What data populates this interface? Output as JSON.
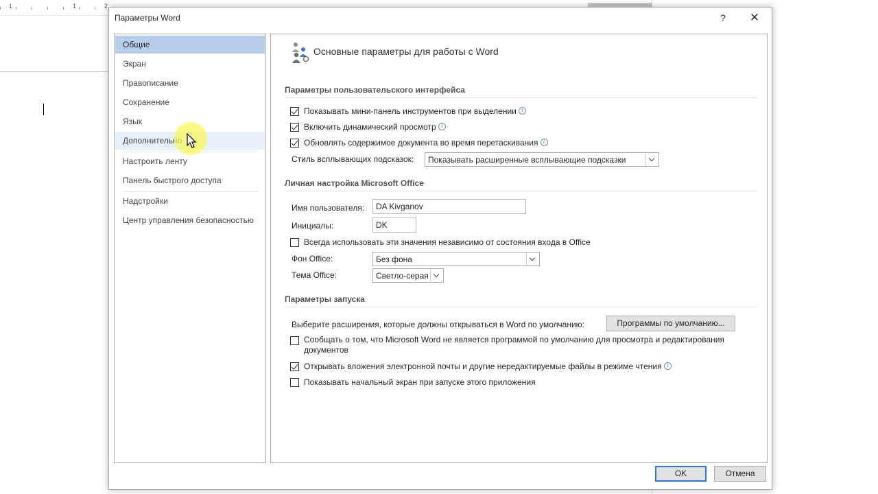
{
  "document": {
    "ruler_numbers": [
      "1",
      "1",
      "2"
    ]
  },
  "dialog": {
    "title": "Параметры Word",
    "help_glyph": "?",
    "close_glyph": "✕"
  },
  "nav": {
    "items": [
      {
        "label": "Общие"
      },
      {
        "label": "Экран"
      },
      {
        "label": "Правописание"
      },
      {
        "label": "Сохранение"
      },
      {
        "label": "Язык"
      },
      {
        "label": "Дополнительно"
      },
      {
        "label": "Настроить ленту"
      },
      {
        "label": "Панель быстрого доступа"
      },
      {
        "label": "Надстройки"
      },
      {
        "label": "Центр управления безопасностью"
      }
    ],
    "selected_index": 0,
    "hover_index": 5
  },
  "content": {
    "header": "Основные параметры для работы с Word",
    "ui_section": {
      "title": "Параметры пользовательского интерфейса",
      "checkboxes": [
        {
          "label": "Показывать мини-панель инструментов при выделении",
          "checked": true,
          "info": true
        },
        {
          "label": "Включить динамический просмотр",
          "checked": true,
          "info": true
        },
        {
          "label": "Обновлять содержимое документа во время перетаскивания",
          "checked": true,
          "info": true
        }
      ],
      "tooltip_style_label": "Стиль всплывающих подсказок:",
      "tooltip_style_value": "Показывать расширенные всплывающие подсказки"
    },
    "personal_section": {
      "title": "Личная настройка Microsoft Office",
      "username_label": "Имя пользователя:",
      "username_value": "DA Kivganov",
      "initials_label": "Инициалы:",
      "initials_value": "DK",
      "always_use_label": "Всегда использовать эти значения независимо от состояния входа в Office",
      "always_use_checked": false,
      "background_label": "Фон Office:",
      "background_value": "Без фона",
      "theme_label": "Тема Office:",
      "theme_value": "Светло-серая"
    },
    "startup_section": {
      "title": "Параметры запуска",
      "extensions_label": "Выберите расширения, которые должны открываться в Word по умолчанию:",
      "default_programs_button": "Программы по умолчанию...",
      "notify_label_line1": "Сообщать о том, что Microsoft Word не является программой по умолчанию для просмотра и редактирования",
      "notify_label_line2": "документов",
      "notify_checked": false,
      "open_attachments_label": "Открывать вложения электронной почты и другие нередактируемые файлы в режиме чтения",
      "open_attachments_checked": true,
      "show_start_label": "Показывать начальный экран при запуске этого приложения",
      "show_start_checked": false
    }
  },
  "footer": {
    "ok_label": "OK",
    "cancel_label": "Отмена"
  },
  "colors": {
    "selected_nav": "#b6cdec",
    "primary_button_border": "#2b79d6",
    "cursor_highlight": "#faf850"
  }
}
